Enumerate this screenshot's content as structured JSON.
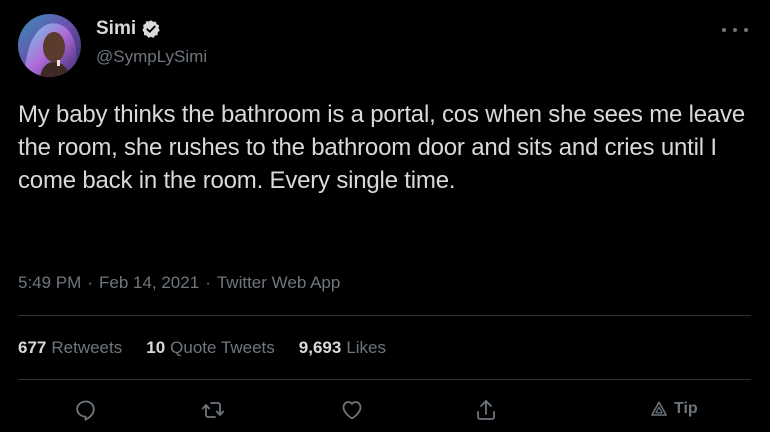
{
  "author": {
    "display_name": "Simi",
    "handle": "@SympLySimi",
    "verified": true
  },
  "tweet": {
    "text": "My baby thinks the bathroom is a portal, cos when she sees me leave the room, she rushes to the bathroom door and sits and cries until I come back in the room. Every single time.",
    "time": "5:49 PM",
    "separator": "·",
    "date": "Feb 14, 2021",
    "source": "Twitter Web App"
  },
  "stats": {
    "retweets_count": "677",
    "retweets_label": "Retweets",
    "quote_count": "10",
    "quote_label": "Quote Tweets",
    "likes_count": "9,693",
    "likes_label": "Likes"
  },
  "actions": {
    "icons": [
      "reply-icon",
      "retweet-icon",
      "like-icon",
      "share-icon",
      "tip-icon"
    ],
    "tip_label": "Tip"
  },
  "colors": {
    "background": "#000000",
    "primary_text": "#d9d9d9",
    "secondary_text": "#6e767d",
    "divider": "#2f3336",
    "verified": "#d9d9d9"
  }
}
